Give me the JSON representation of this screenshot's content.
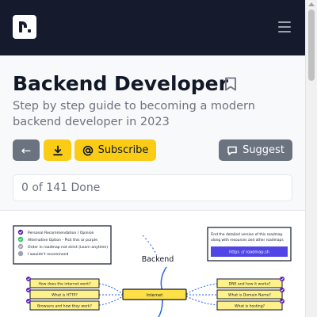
{
  "nav": {
    "logo_label": "r.",
    "menu_icon": "hamburger-icon"
  },
  "header": {
    "title": "Backend Developer",
    "subtitle": "Step by step guide to becoming a modern backend developer in 2023",
    "bookmark_icon": "bookmark-icon"
  },
  "actions": {
    "back_label": "←",
    "download_icon": "download-icon",
    "subscribe_label": "Subscribe",
    "subscribe_icon": "at-icon",
    "suggest_label": "Suggest",
    "suggest_icon": "chat-icon"
  },
  "progress": {
    "text": "0 of 141 Done"
  },
  "roadmap": {
    "legend": [
      {
        "text": "Personal Recommendation / Opinion",
        "color": "#5b21b6",
        "kind": "check"
      },
      {
        "text": "Alternative Option - Pick this or purple",
        "color": "#22c55e",
        "kind": "check"
      },
      {
        "text": "Order in roadmap not strict (Learn anytime)",
        "color": "#9ca3af",
        "kind": "check"
      },
      {
        "text": "I wouldn't recommend",
        "color": "#9ca3af",
        "kind": "dot"
      }
    ],
    "info_box": {
      "text_line1": "Find the detailed version of this roadmap",
      "text_line2": "along with resources and other roadmaps",
      "link_label": "https :// roadmap.sh"
    },
    "center_title": "Backend",
    "main_node": "Internet",
    "left_nodes": [
      "How does the internet work?",
      "What is HTTP?",
      "Browsers and how they work?"
    ],
    "right_nodes": [
      "DNS and how it works?",
      "What is Domain Name?",
      "What is hosting?"
    ],
    "colors": {
      "node_fill": "#fde047",
      "node_border": "#111827",
      "main_fill": "#fef08a",
      "link_blue": "#2563eb",
      "link_button": "#4f46e5",
      "check_purple": "#5b21b6"
    }
  }
}
